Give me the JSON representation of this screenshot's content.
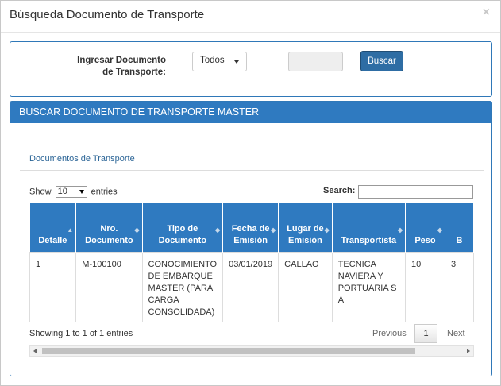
{
  "modal": {
    "title": "Búsqueda Documento de Transporte",
    "close_glyph": "×"
  },
  "search": {
    "label": "Ingresar Documento de Transporte:",
    "select_value": "Todos",
    "input_value": "",
    "button_label": "Buscar"
  },
  "results": {
    "heading": "BUSCAR DOCUMENTO DE TRANSPORTE MASTER",
    "tab_label": "Documentos de Transporte",
    "show_prefix": "Show",
    "length_value": "10",
    "show_suffix": "entries",
    "search_label": "Search:",
    "columns": [
      "Detalle",
      "Nro. Documento",
      "Tipo de Documento",
      "Fecha de Emisión",
      "Lugar de Emisión",
      "Transportista",
      "Peso",
      "B"
    ],
    "rows": [
      [
        "1",
        "M-100100",
        "CONOCIMIENTO DE EMBARQUE MASTER (PARA CARGA CONSOLIDADA)",
        "03/01/2019",
        "CALLAO",
        "TECNICA NAVIERA Y PORTUARIA S A",
        "10",
        "3"
      ]
    ],
    "info": "Showing 1 to 1 of 1 entries",
    "pager": {
      "previous": "Previous",
      "current": "1",
      "next": "Next"
    }
  },
  "colors": {
    "primary": "#2f7ac0",
    "button": "#2e6da4",
    "link": "#2a6496"
  }
}
